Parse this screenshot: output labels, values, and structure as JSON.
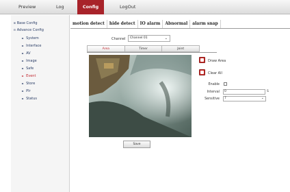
{
  "nav": {
    "items": [
      {
        "label": "Preview"
      },
      {
        "label": "Log"
      },
      {
        "label": "Config"
      },
      {
        "label": "LogOut"
      }
    ]
  },
  "sidebar": {
    "groups": [
      {
        "sign": "⊞",
        "label": "Base Config"
      },
      {
        "sign": "⊟",
        "label": "Advance Config"
      }
    ],
    "items": [
      {
        "label": "System"
      },
      {
        "label": "Interface"
      },
      {
        "label": "AV"
      },
      {
        "label": "Image"
      },
      {
        "label": "Safe"
      },
      {
        "label": "Event"
      },
      {
        "label": "Store"
      },
      {
        "label": "PIr"
      },
      {
        "label": "Status"
      }
    ]
  },
  "tabs": [
    {
      "label": "motion detect"
    },
    {
      "label": "hide detect"
    },
    {
      "label": "IO alarm"
    },
    {
      "label": "Abnormal"
    },
    {
      "label": "alarm snap"
    }
  ],
  "channel": {
    "label": "Channel",
    "value": "Channel 01"
  },
  "subtabs": [
    {
      "label": "Area"
    },
    {
      "label": "Timer"
    },
    {
      "label": "Joint"
    }
  ],
  "tools": {
    "draw_label": "Draw Area",
    "clear_label": "Clear All"
  },
  "form": {
    "enable_label": "Enable",
    "interval_label": "Interval",
    "interval_value": "0",
    "interval_suffix": "S",
    "sensitive_label": "Sensitive",
    "sensitive_value": "7"
  },
  "save_label": "Save",
  "colors": {
    "accent": "#a8232a",
    "link": "#2a3d66",
    "active_item": "#c0262e"
  }
}
